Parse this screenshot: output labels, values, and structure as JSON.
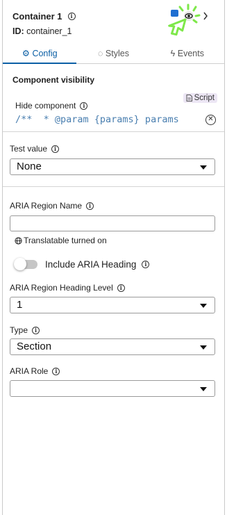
{
  "header": {
    "title": "Container 1",
    "id_label": "ID:",
    "id_value": "container_1"
  },
  "tabs": [
    {
      "label": "Config",
      "icon": "gear-icon",
      "active": true
    },
    {
      "label": "Styles",
      "icon": "palette-icon",
      "active": false
    },
    {
      "label": "Events",
      "icon": "bolt-icon",
      "active": false
    }
  ],
  "visibility": {
    "section_title": "Component visibility",
    "script_label": "Script",
    "hide_label": "Hide component",
    "code_value": "/**  * @param {params} params"
  },
  "test_value": {
    "label": "Test value",
    "selected": "None"
  },
  "aria_region_name": {
    "label": "ARIA Region Name",
    "value": "",
    "translatable_text": "Translatable turned on"
  },
  "include_heading": {
    "label": "Include ARIA Heading",
    "checked": false
  },
  "heading_level": {
    "label": "ARIA Region Heading Level",
    "selected": "1"
  },
  "type": {
    "label": "Type",
    "selected": "Section"
  },
  "aria_role": {
    "label": "ARIA Role",
    "selected": ""
  },
  "colors": {
    "accent": "#0b5fa5",
    "code": "#4a7fb0",
    "script_badge_bg": "#ece6f4",
    "highlight_green": "#7ee84a"
  }
}
